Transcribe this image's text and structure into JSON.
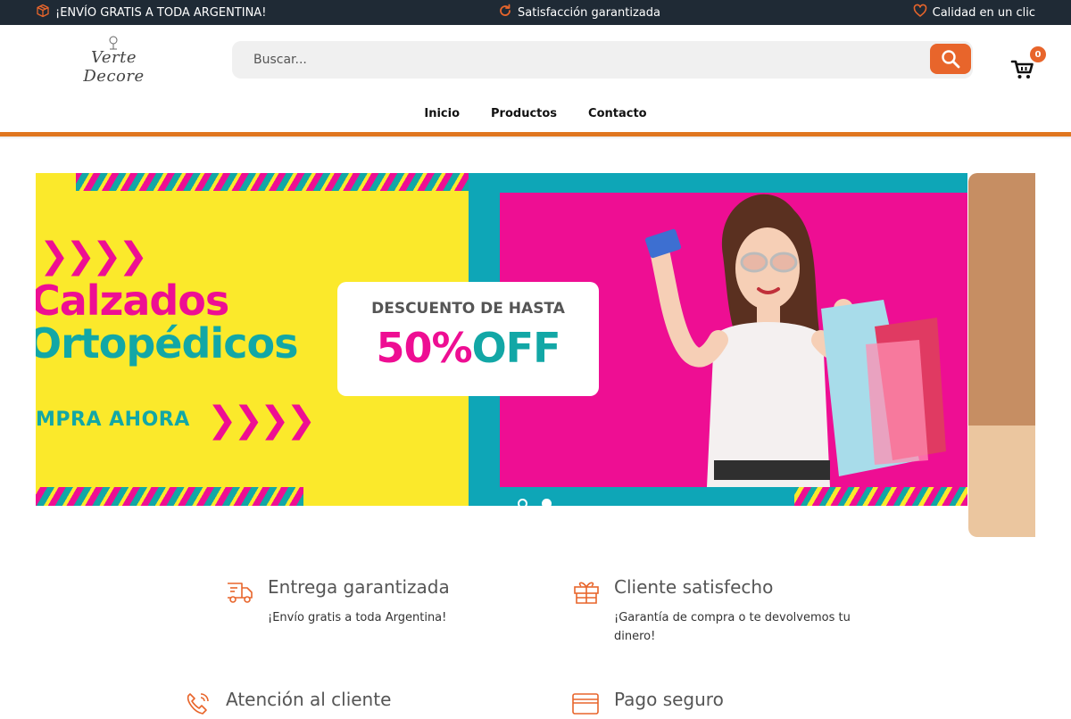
{
  "topbar": {
    "left_text": "¡ENVÍO GRATIS A TODA ARGENTINA!",
    "center_text": "Satisfacción garantizada",
    "right_text": "Calidad en un clic"
  },
  "header": {
    "logo_text": "Verte Decore",
    "search_placeholder": "Buscar...",
    "cart_count": "0"
  },
  "nav": {
    "items": [
      "Inicio",
      "Productos",
      "Contacto"
    ]
  },
  "banner": {
    "line1": "Calzados",
    "line2": "Ortopédicos",
    "cta": "MPRA AHORA",
    "chevrons": "❯❯❯❯",
    "promo_line1": "DESCUENTO DE HASTA",
    "promo_percent": "50%",
    "promo_off": "OFF",
    "slides": 2,
    "active_slide": 2
  },
  "features": [
    {
      "title": "Entrega garantizada",
      "desc": "¡Envío gratis a toda Argentina!",
      "icon": "truck-icon"
    },
    {
      "title": "Cliente satisfecho",
      "desc": "¡Garantía de compra o te devolvemos tu dinero!",
      "icon": "gift-icon"
    },
    {
      "title": "Atención al cliente",
      "desc": "",
      "icon": "phone-icon"
    },
    {
      "title": "Pago seguro",
      "desc": "",
      "icon": "card-icon"
    }
  ],
  "colors": {
    "topbar_bg": "#1f2a35",
    "accent_orange": "#e8652b",
    "banner_yellow": "#fbe92b",
    "banner_pink": "#ee0e93",
    "banner_teal": "#12a7a6"
  }
}
